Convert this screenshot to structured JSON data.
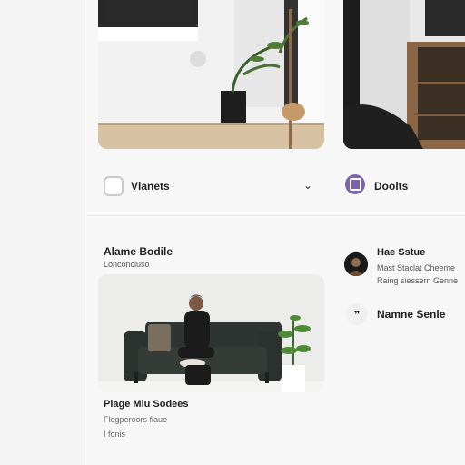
{
  "filters": {
    "left": {
      "label": "Vlanets"
    },
    "right": {
      "label": "Doolts"
    }
  },
  "section": {
    "title": "Alame Bodile",
    "subtitle": "Lonconcluso"
  },
  "feature_card": {
    "title": "Plage Mlu Sodees",
    "line1": "Flogperoors fiaue",
    "line2": "I fonis"
  },
  "profile": {
    "name": "Hae Sstue",
    "line1": "Mast Staclat Cheeme",
    "line2": "Raing siessern Genne"
  },
  "name_row": {
    "icon_text": "❞",
    "label": "Namne Senle"
  },
  "colors": {
    "accent_purple": "#7d62a9",
    "background": "#f7f7f7",
    "sofa": "#2e3431"
  },
  "icons": {
    "checkbox": "checkbox-icon",
    "chevron": "chevron-down-icon",
    "doc": "document-icon",
    "quote": "quote-icon"
  }
}
